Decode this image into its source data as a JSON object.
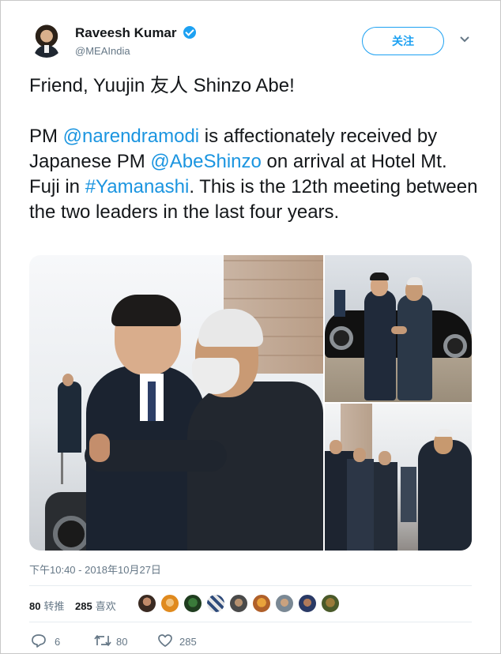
{
  "author": {
    "name": "Raveesh Kumar",
    "handle": "@MEAIndia",
    "verified": true
  },
  "follow_button": {
    "label": "关注"
  },
  "tweet": {
    "line1": "Friend, Yuujin 友人 Shinzo Abe!",
    "p2": {
      "t1": "PM ",
      "m1": "@narendramodi",
      "t2": " is affectionately received by Japanese PM ",
      "m2": "@AbeShinzo",
      "t3": " on arrival at Hotel Mt. Fuji in ",
      "hashtag": "#Yamanashi",
      "t4": ". This is the 12th meeting between the two leaders in the last four years."
    },
    "link_color": "#1b95e0"
  },
  "photos": {
    "count": 3
  },
  "timestamp": "下午10:40 - 2018年10月27日",
  "stats": {
    "retweets": {
      "count": "80",
      "label": "转推"
    },
    "likes": {
      "count": "285",
      "label": "喜欢"
    },
    "liker_avatars": 9
  },
  "actions": {
    "reply": {
      "icon": "reply-icon",
      "count": "6"
    },
    "retweet": {
      "icon": "retweet-icon",
      "count": "80"
    },
    "like": {
      "icon": "heart-icon",
      "count": "285"
    }
  },
  "colors": {
    "accent": "#1da1f2",
    "muted": "#657786",
    "text": "#14171a"
  }
}
